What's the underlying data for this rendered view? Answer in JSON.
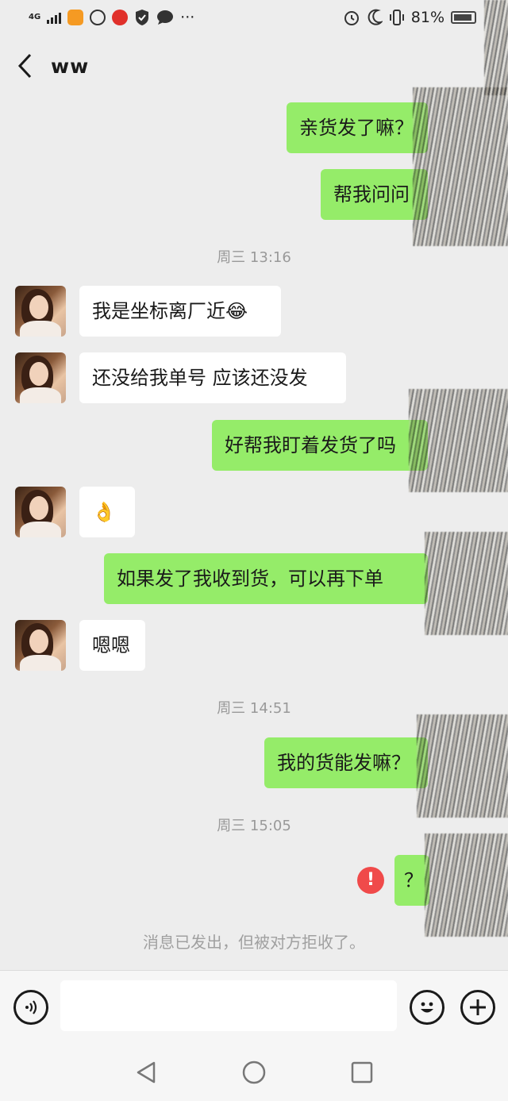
{
  "status_bar": {
    "network": "4G",
    "battery_percent": "81%",
    "icons": [
      "signal-icon",
      "uc-browser-icon",
      "app-icon",
      "weibo-icon",
      "shield-icon",
      "chat-bubble-icon",
      "more-icon",
      "alarm-icon",
      "moon-icon",
      "vibrate-icon",
      "battery-icon"
    ],
    "more": "···"
  },
  "header": {
    "title": "ww",
    "back_icon": "chevron-left-icon"
  },
  "messages": [
    {
      "from": "me",
      "text": "亲货发了嘛？"
    },
    {
      "from": "me",
      "text": "帮我问问"
    },
    {
      "type": "timestamp",
      "text": "周三 13:16"
    },
    {
      "from": "them",
      "text": "我是坐标离厂近😂"
    },
    {
      "from": "them",
      "text": "还没给我单号 应该还没发"
    },
    {
      "from": "me",
      "text": "好帮我盯着发货了吗"
    },
    {
      "from": "them",
      "text": "👌"
    },
    {
      "from": "me",
      "text": "如果发了我收到货，可以再下单"
    },
    {
      "from": "them",
      "text": "嗯嗯"
    },
    {
      "type": "timestamp",
      "text": "周三 14:51"
    },
    {
      "from": "me",
      "text": "我的货能发嘛？"
    },
    {
      "type": "timestamp",
      "text": "周三 15:05"
    },
    {
      "from": "me",
      "text": "？",
      "failed": true,
      "error_mark": "!"
    },
    {
      "type": "system",
      "text": "消息已发出，但被对方拒收了。"
    }
  ],
  "input_bar": {
    "voice_icon": "voice-icon",
    "input_value": "",
    "emoji_icon": "emoji-icon",
    "plus_icon": "plus-icon"
  },
  "nav_bar": {
    "back_icon": "triangle-back-icon",
    "home_icon": "circle-home-icon",
    "recent_icon": "square-recent-icon"
  },
  "colors": {
    "background": "#ededed",
    "my_bubble": "#95ec69",
    "their_bubble": "#ffffff",
    "error": "#f04a4a"
  }
}
